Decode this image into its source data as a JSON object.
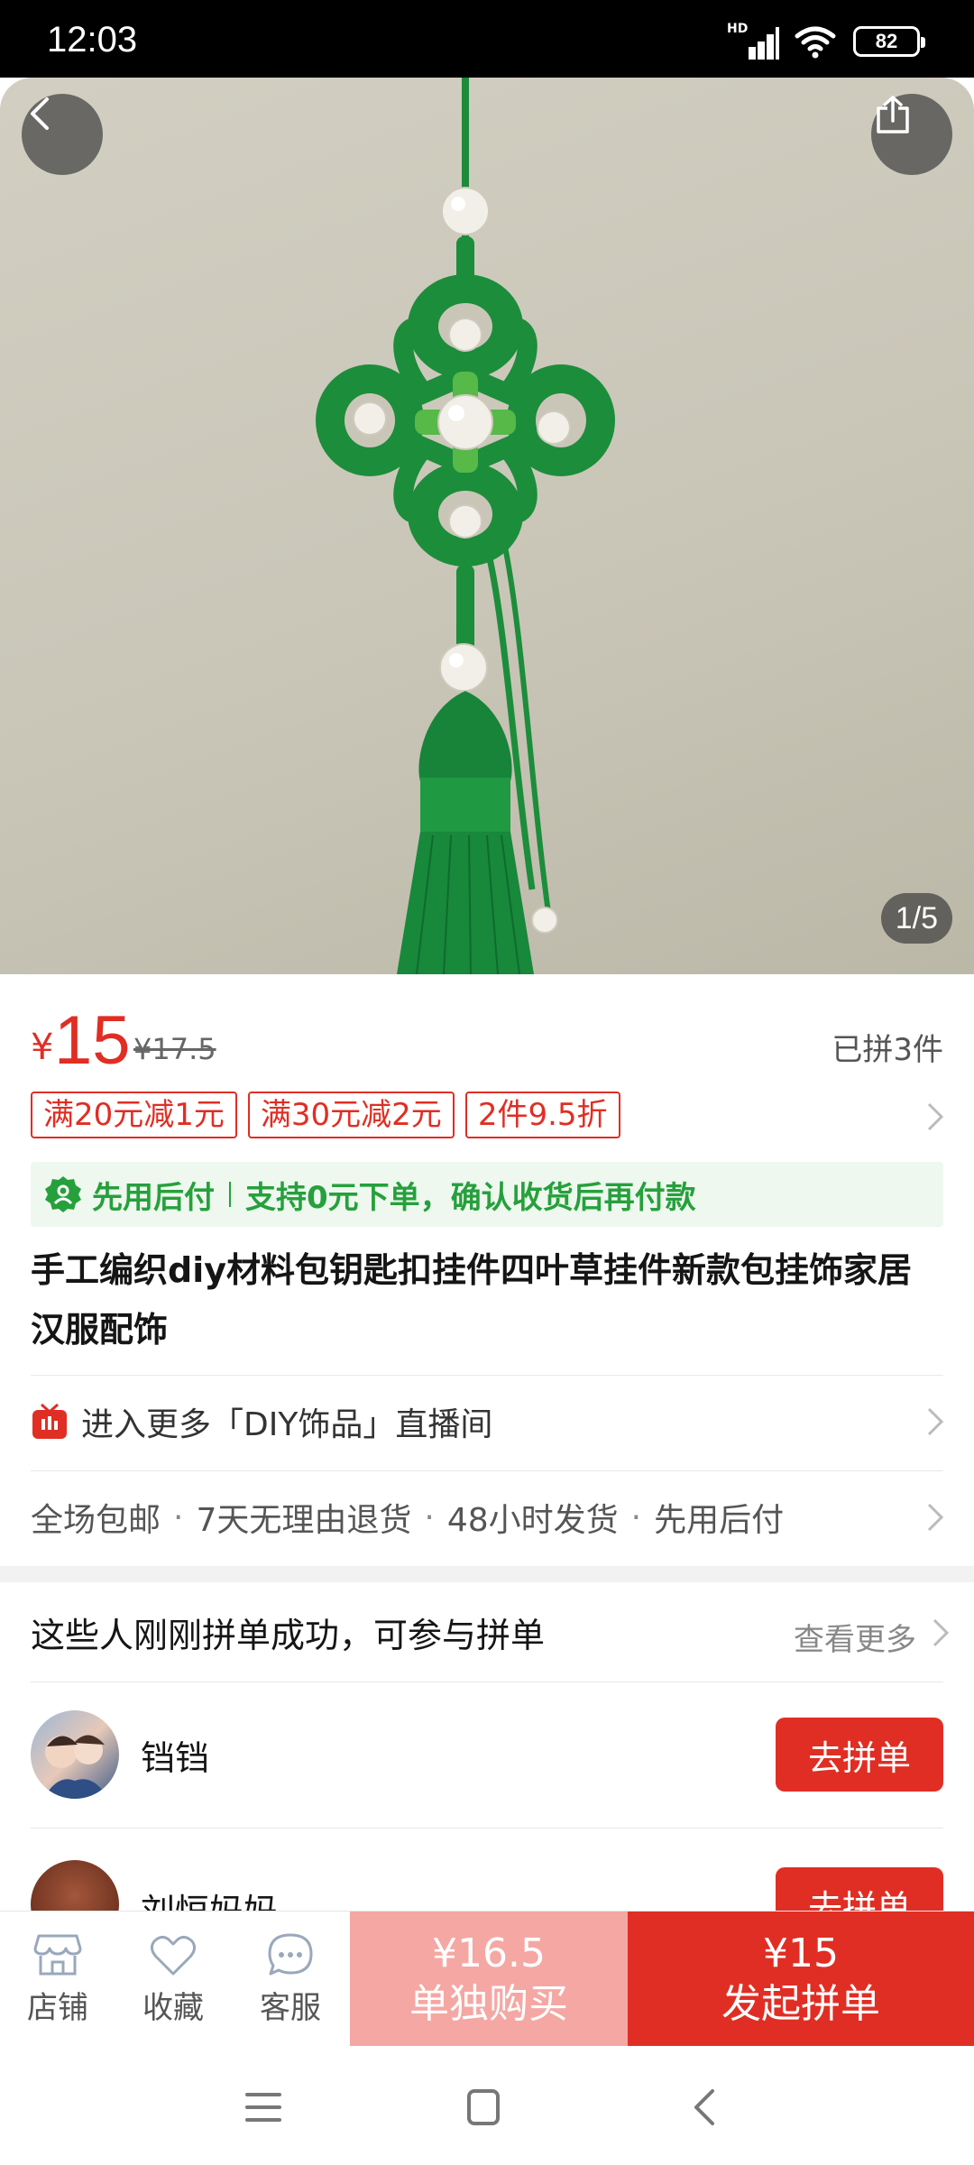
{
  "status_bar": {
    "time": "12:03",
    "network": "HD",
    "battery": "82"
  },
  "hero": {
    "page_indicator": "1/5"
  },
  "price": {
    "currency": "¥",
    "current": "15",
    "original": "¥17.5",
    "sold": "已拼3件"
  },
  "coupons": [
    "满20元减1元",
    "满30元减2元",
    "2件9.5折"
  ],
  "paylater": {
    "label": "先用后付",
    "text": "支持0元下单，确认收货后再付款"
  },
  "title": "手工编织diy材料包钥匙扣挂件四叶草挂件新款包挂饰家居汉服配饰",
  "live": {
    "text": "进入更多「DIY饰品」直播间"
  },
  "services": [
    "全场包邮",
    "7天无理由退货",
    "48小时发货",
    "先用后付"
  ],
  "group_buy": {
    "header": "这些人刚刚拼单成功，可参与拼单",
    "more": "查看更多",
    "rows": [
      {
        "name": "铛铛",
        "button": "去拼单"
      },
      {
        "name": "刘恒妈妈",
        "button": "去拼单"
      }
    ]
  },
  "bottom_bar": {
    "store": "店铺",
    "favorite": "收藏",
    "service": "客服",
    "buy_alone_price": "¥16.5",
    "buy_alone_label": "单独购买",
    "buy_group_price": "¥15",
    "buy_group_label": "发起拼单"
  },
  "colors": {
    "accent": "#e02e24",
    "paylater_green": "#26a03c",
    "buy_alone_bg": "#f5a7a3"
  }
}
